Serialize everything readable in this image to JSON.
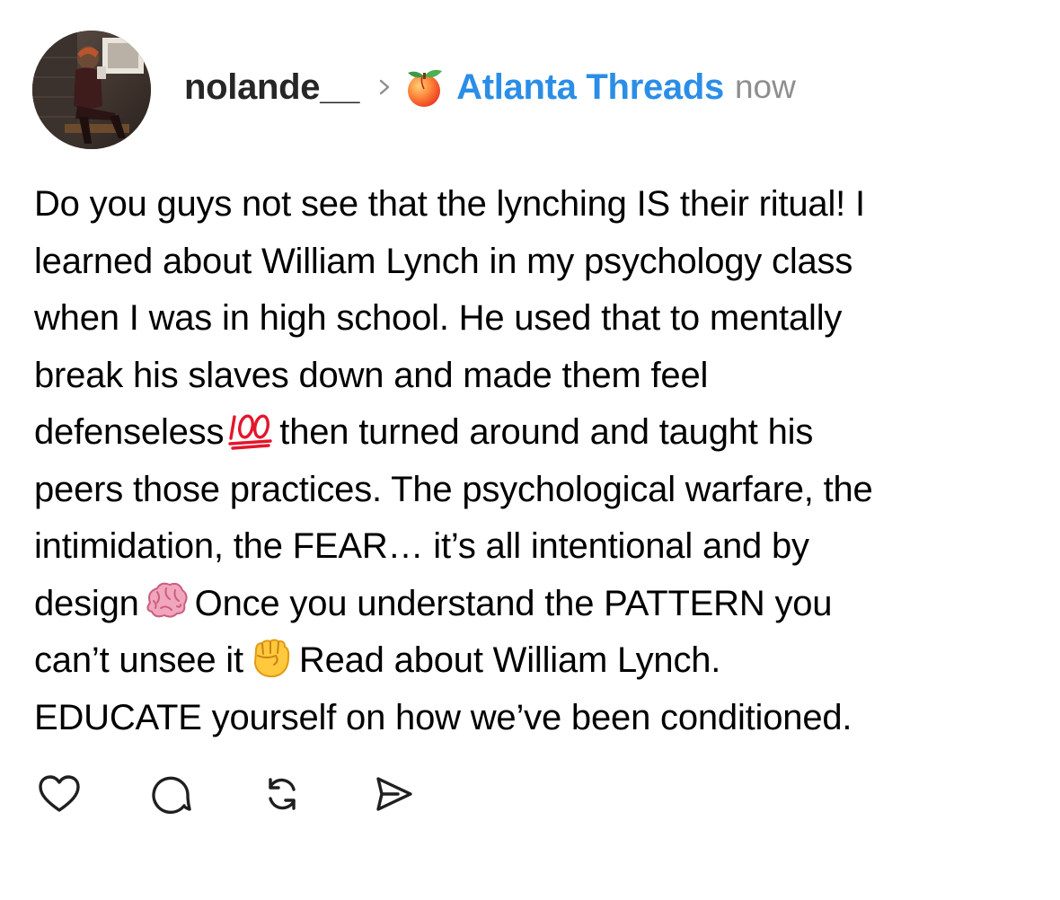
{
  "post": {
    "username": "nolande__",
    "community": "Atlanta Threads",
    "timestamp": "now",
    "body_lines": [
      "Do you guys not see that the lynching IS their ritual! I",
      "learned about William Lynch in my psychology class",
      "when I was in high school. He used that to mentally",
      "break his slaves down and made them feel",
      "defenseless",
      "then turned around and taught his",
      "peers those practices. The psychological warfare, the",
      "intimidation, the FEAR… it’s all intentional and by",
      "design",
      "Once you understand the PATTERN you",
      "can’t unsee it",
      "Read about William Lynch.",
      "EDUCATE yourself on how we’ve been conditioned."
    ],
    "emojis": [
      "hundred-points-emoji",
      "brain-emoji",
      "raised-fist-emoji"
    ]
  },
  "actions": {
    "icons": [
      "heart-icon",
      "comment-icon",
      "repost-icon",
      "share-icon"
    ]
  },
  "colors": {
    "username": "#262626",
    "community_link": "#2b8ee6",
    "timestamp": "#8e8e8e",
    "icon_stroke": "#1f1f1f"
  }
}
